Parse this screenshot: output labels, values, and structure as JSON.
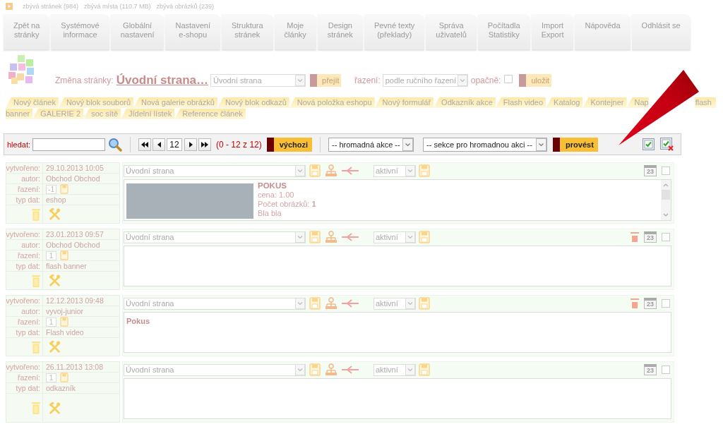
{
  "status_line": {
    "items": [
      "zbývá stránek (984)",
      "zbývá místa (110.7 MB)",
      "zbývá obrázků (239)"
    ]
  },
  "main_menu": [
    {
      "lines": [
        "Zpět na",
        "stránky"
      ]
    },
    {
      "lines": [
        "Systémové",
        "informace"
      ]
    },
    {
      "lines": [
        "Globální",
        "nastavení"
      ]
    },
    {
      "lines": [
        "Nastavení",
        "e-shopu"
      ]
    },
    {
      "lines": [
        "Struktura",
        "stránek"
      ]
    },
    {
      "lines": [
        "Moje",
        "články"
      ]
    },
    {
      "lines": [
        "Design",
        "stránek"
      ]
    },
    {
      "lines": [
        "Pevné texty",
        "(překlady)"
      ]
    },
    {
      "lines": [
        "Správa",
        "uživatelů"
      ]
    },
    {
      "lines": [
        "Počítadla",
        "Statistiky"
      ]
    },
    {
      "lines": [
        "Import",
        "Export"
      ]
    },
    {
      "lines": [
        "Nápověda"
      ]
    },
    {
      "lines": [
        "Odhlásit se"
      ]
    }
  ],
  "page_switch": {
    "label": "Změna stránky:",
    "current_page": "Úvodní strana…",
    "page_select": "Úvodní strana",
    "go_button": "přejít",
    "sort_label": "řazení:",
    "sort_select": "podle ručního řazení",
    "reverse_label": "opačně:",
    "reverse_checked": false,
    "save_button": "uložit"
  },
  "new_item_tabs": [
    [
      {
        "label": "Nový článek",
        "kind": "tab"
      },
      {
        "label": "Nový blok souborů",
        "kind": "tab"
      },
      {
        "label": "Nová galerie obrázků",
        "kind": "tab"
      },
      {
        "label": "Nový blok odkazů",
        "kind": "tab"
      },
      {
        "label": "Nová položka eshopu",
        "kind": "tab"
      },
      {
        "label": "Nový formulář",
        "kind": "tab"
      },
      {
        "label": "Odkazník akce",
        "kind": "tab"
      },
      {
        "label": "Flash video",
        "kind": "tab"
      },
      {
        "label": "Katalog",
        "kind": "tab"
      },
      {
        "label": "Kontejner",
        "kind": "tab"
      },
      {
        "label": "Nap",
        "kind": "covered"
      },
      {
        "label": "flash",
        "kind": "wrap_start"
      }
    ],
    [
      {
        "label": "banner",
        "kind": "wrap_end"
      },
      {
        "label": "GALERIE 2",
        "kind": "tab"
      },
      {
        "label": "soc sítě",
        "kind": "tab"
      },
      {
        "label": "Jídelní lístek",
        "kind": "tab"
      },
      {
        "label": "Reference článek",
        "kind": "tab"
      }
    ]
  ],
  "toolbar": {
    "search_label": "hledat:",
    "page": "12",
    "range": "(0 - 12 z 12)",
    "default_button": "výchozi",
    "bulk_action": "-- hromadná akce --",
    "bulk_section": "-- sekce pro hromadnou akci --",
    "run_button": "provést"
  },
  "entries": [
    {
      "fields": [
        {
          "label": "vytvořeno:",
          "value": "29.10.2013 10:05",
          "kind": "text"
        },
        {
          "label": "autor:",
          "value": "Obchod Obchod",
          "kind": "text"
        },
        {
          "label": "řazení:",
          "value": "-1",
          "kind": "input"
        },
        {
          "label": "typ dat:",
          "value": "eshop",
          "kind": "text"
        }
      ],
      "section": "Úvodní strana",
      "status": "aktivní",
      "flagged": false,
      "calendar_day": "23",
      "checked": false,
      "content": {
        "kind": "product",
        "title": "POKUS",
        "lines": [
          "cena: 1.00",
          "Počet obrázků: **1**",
          "Bla bla"
        ]
      }
    },
    {
      "fields": [
        {
          "label": "vytvořeno:",
          "value": "23.01.2013 09:57",
          "kind": "text"
        },
        {
          "label": "autor:",
          "value": "Obchod Obchod",
          "kind": "text"
        },
        {
          "label": "řazení:",
          "value": "1",
          "kind": "input"
        },
        {
          "label": "typ dat:",
          "value": "flash banner",
          "kind": "text"
        }
      ],
      "section": "Úvodní strana",
      "status": "aktivní",
      "flagged": true,
      "calendar_day": "23",
      "checked": false
    },
    {
      "fields": [
        {
          "label": "vytvořeno:",
          "value": "12.12.2013 09:48",
          "kind": "text"
        },
        {
          "label": "autor:",
          "value": "vyvoj-junior",
          "kind": "text"
        },
        {
          "label": "řazení:",
          "value": "1",
          "kind": "input"
        },
        {
          "label": "typ dat:",
          "value": "Flash video",
          "kind": "text"
        }
      ],
      "section": "Úvodní strana",
      "status": "aktivní",
      "flagged": true,
      "calendar_day": "23",
      "checked": false,
      "content": {
        "kind": "text",
        "title": "Pokus"
      }
    },
    {
      "fields": [
        {
          "label": "vytvořeno:",
          "value": "26.11.2013 13:08",
          "kind": "text"
        },
        {
          "label": "řazení:",
          "value": "1",
          "kind": "input"
        },
        {
          "label": "typ dat:",
          "value": "odkazník",
          "kind": "text"
        }
      ],
      "section": "Úvodní strana",
      "status": "aktivní",
      "flagged": false,
      "calendar_day": "23",
      "checked": false
    }
  ]
}
